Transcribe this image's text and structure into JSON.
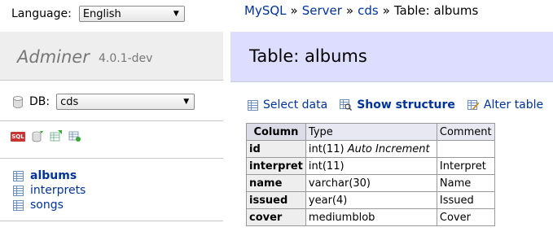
{
  "language": {
    "label": "Language:",
    "selected": "English"
  },
  "brand": {
    "name": "Adminer",
    "version": "4.0.1-dev"
  },
  "db": {
    "label": "DB:",
    "selected": "cds"
  },
  "tools": [
    "sql-command-icon",
    "import-icon",
    "export-icon",
    "create-table-icon"
  ],
  "tables": [
    {
      "name": "albums",
      "active": true
    },
    {
      "name": "interprets",
      "active": false
    },
    {
      "name": "songs",
      "active": false
    }
  ],
  "breadcrumb": {
    "mysql": "MySQL",
    "server": "Server",
    "db": "cds",
    "current": "Table: albums",
    "separator": "»"
  },
  "page_title": "Table: albums",
  "links": {
    "select": "Select data",
    "structure": "Show structure",
    "alter": "Alter table"
  },
  "structure": {
    "headers": {
      "column": "Column",
      "type": "Type",
      "comment": "Comment"
    },
    "rows": [
      {
        "column": "id",
        "type": "int(11)",
        "extra": "Auto Increment",
        "comment": ""
      },
      {
        "column": "interpret",
        "type": "int(11)",
        "extra": "",
        "comment": "Interpret"
      },
      {
        "column": "name",
        "type": "varchar(30)",
        "extra": "",
        "comment": "Name"
      },
      {
        "column": "issued",
        "type": "year(4)",
        "extra": "",
        "comment": "Issued"
      },
      {
        "column": "cover",
        "type": "mediumblob",
        "extra": "",
        "comment": "Cover"
      }
    ]
  }
}
